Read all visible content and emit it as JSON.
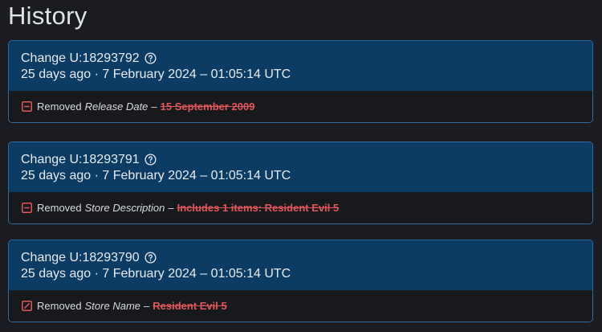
{
  "page": {
    "title": "History"
  },
  "colors": {
    "card_header": "#0c3b63",
    "card_border": "#2f6aa0",
    "removed": "#e0575b",
    "background": "#1b1c21"
  },
  "changes": [
    {
      "change_label": "Change U:18293792",
      "date": "25 days ago · 7 February 2024 – 01:05:14 UTC",
      "action": "Removed",
      "field": "Release Date",
      "separator": "–",
      "old_value": "15 September 2009",
      "icon": "minus-square-icon"
    },
    {
      "change_label": "Change U:18293791",
      "date": "25 days ago · 7 February 2024 – 01:05:14 UTC",
      "action": "Removed",
      "field": "Store Description",
      "separator": "–",
      "old_value": "Includes 1 items: Resident Evil 5",
      "icon": "minus-square-icon"
    },
    {
      "change_label": "Change U:18293790",
      "date": "25 days ago · 7 February 2024 – 01:05:14 UTC",
      "action": "Removed",
      "field": "Store Name",
      "separator": "–",
      "old_value": "Resident Evil 5",
      "icon": "slash-square-icon"
    }
  ]
}
